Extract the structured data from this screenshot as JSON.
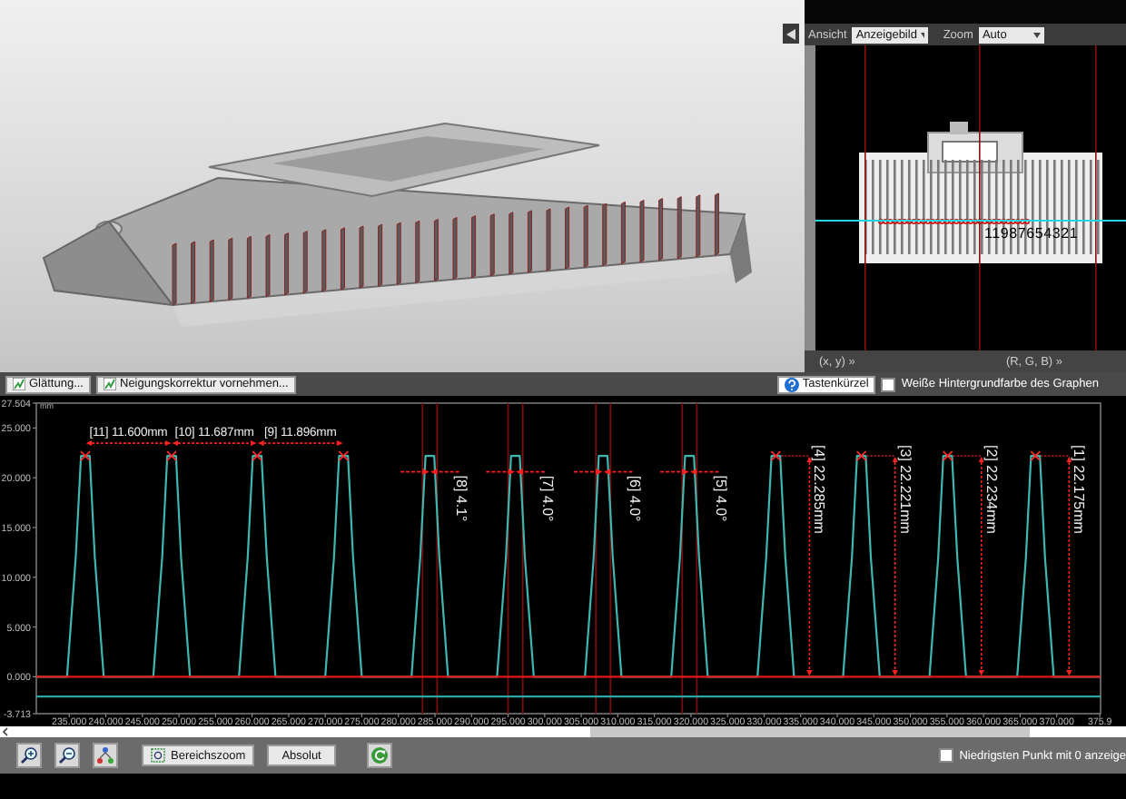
{
  "image_view": {
    "view_label": "Ansicht",
    "view_value": "Anzeigebild",
    "zoom_label": "Zoom",
    "zoom_value": "Auto",
    "peak_numbers": "11987654321",
    "coords_label": "(x, y) »",
    "color_label": "(R, G, B) »"
  },
  "task_tabs": [
    {
      "label": "Glättung..."
    },
    {
      "label": "Neigungskorrektur vornehmen..."
    }
  ],
  "shortcut_button": "Tastenkürzel",
  "white_background": {
    "label": "Weiße Hintergrundfarbe des Graphen",
    "checked": false
  },
  "chart": {
    "unit": "mm",
    "chart_data": {
      "type": "line",
      "xlim": [
        230.5,
        376
      ],
      "ylim": [
        -3.713,
        27.504
      ],
      "x": [
        230.5,
        234.7,
        235.9,
        236.6,
        237.8,
        238.5,
        239.7,
        246.5,
        247.7,
        248.4,
        249.6,
        250.3,
        251.5,
        258.2,
        259.4,
        260.1,
        261.3,
        262.0,
        263.2,
        270.0,
        271.2,
        271.9,
        273.1,
        273.8,
        275.0,
        281.8,
        283.0,
        283.7,
        284.9,
        285.6,
        286.8,
        293.5,
        294.7,
        295.4,
        296.6,
        297.3,
        298.5,
        305.5,
        306.7,
        307.4,
        308.6,
        309.3,
        310.5,
        317.3,
        318.5,
        319.2,
        320.4,
        321.1,
        322.3,
        329.1,
        330.3,
        331.0,
        332.2,
        332.9,
        334.1,
        340.8,
        342.0,
        342.7,
        343.9,
        344.6,
        345.8,
        352.6,
        353.8,
        354.5,
        355.7,
        356.4,
        357.6,
        364.6,
        365.8,
        366.5,
        367.7,
        368.4,
        369.6,
        376
      ],
      "series": [
        {
          "color": "#3fb6b0",
          "values": [
            0,
            0,
            12,
            22.2,
            22.2,
            12,
            0,
            0,
            12,
            22.2,
            22.2,
            12,
            0,
            0,
            12,
            22.2,
            22.2,
            12,
            0,
            0,
            12,
            22.2,
            22.2,
            12,
            0,
            0,
            12,
            22.2,
            22.2,
            12,
            0,
            0,
            12,
            22.2,
            22.2,
            12,
            0,
            0,
            12,
            22.2,
            22.2,
            12,
            0,
            0,
            12,
            22.2,
            22.2,
            12,
            0,
            0,
            12,
            22.2,
            22.2,
            12,
            0,
            0,
            12,
            22.2,
            22.2,
            12,
            0,
            0,
            12,
            22.2,
            22.2,
            12,
            0,
            0,
            12,
            22.2,
            22.2,
            12,
            0,
            0
          ]
        },
        {
          "color": "#e01818",
          "values": [
            0,
            0,
            0,
            0,
            0,
            0,
            0,
            0,
            0,
            0,
            0,
            0,
            0,
            0,
            0,
            0,
            0,
            0,
            0,
            0,
            0,
            0,
            0,
            0,
            0,
            0,
            0,
            0,
            0,
            0,
            0,
            0,
            0,
            0,
            0,
            0,
            0,
            0,
            0,
            0,
            0,
            0,
            0,
            0,
            0,
            0,
            0,
            0,
            0,
            0,
            0,
            0,
            0,
            0,
            0,
            0,
            0,
            0,
            0,
            0,
            0,
            0,
            0,
            0,
            0,
            0,
            0,
            0,
            0,
            0,
            0,
            0,
            0,
            0
          ]
        },
        {
          "color": "#2aa7a7",
          "values": [
            -2,
            -2,
            -2,
            -2,
            -2,
            -2,
            -2,
            -2,
            -2,
            -2,
            -2,
            -2,
            -2,
            -2,
            -2,
            -2,
            -2,
            -2,
            -2,
            -2,
            -2,
            -2,
            -2,
            -2,
            -2,
            -2,
            -2,
            -2,
            -2,
            -2,
            -2,
            -2,
            -2,
            -2,
            -2,
            -2,
            -2,
            -2,
            -2,
            -2,
            -2,
            -2,
            -2,
            -2,
            -2,
            -2,
            -2,
            -2,
            -2,
            -2,
            -2,
            -2,
            -2,
            -2,
            -2,
            -2,
            -2,
            -2,
            -2,
            -2,
            -2,
            -2,
            -2,
            -2,
            -2,
            -2,
            -2,
            -2,
            -2,
            -2,
            -2,
            -2,
            -2,
            -2
          ]
        }
      ],
      "xticks": [
        {
          "value": 235,
          "label": "235.000"
        },
        {
          "value": 240,
          "label": "240.000"
        },
        {
          "value": 245,
          "label": "245.000"
        },
        {
          "value": 250,
          "label": "250.000"
        },
        {
          "value": 255,
          "label": "255.000"
        },
        {
          "value": 260,
          "label": "260.000"
        },
        {
          "value": 265,
          "label": "265.000"
        },
        {
          "value": 270,
          "label": "270.000"
        },
        {
          "value": 275,
          "label": "275.000"
        },
        {
          "value": 280,
          "label": "280.000"
        },
        {
          "value": 285,
          "label": "285.000"
        },
        {
          "value": 290,
          "label": "290.000"
        },
        {
          "value": 295,
          "label": "295.000"
        },
        {
          "value": 300,
          "label": "300.000"
        },
        {
          "value": 305,
          "label": "305.000"
        },
        {
          "value": 310,
          "label": "310.000"
        },
        {
          "value": 315,
          "label": "315.000"
        },
        {
          "value": 320,
          "label": "320.000"
        },
        {
          "value": 325,
          "label": "325.000"
        },
        {
          "value": 330,
          "label": "330.000"
        },
        {
          "value": 335,
          "label": "335.000"
        },
        {
          "value": 340,
          "label": "340.000"
        },
        {
          "value": 345,
          "label": "345.000"
        },
        {
          "value": 350,
          "label": "350.000"
        },
        {
          "value": 355,
          "label": "355.000"
        },
        {
          "value": 360,
          "label": "360.000"
        },
        {
          "value": 365,
          "label": "365.000"
        },
        {
          "value": 370,
          "label": "370.000"
        },
        {
          "value": 375.9,
          "label": "375.9"
        }
      ],
      "yticks": [
        {
          "value": -3.713,
          "label": "-3.713"
        },
        {
          "value": 0,
          "label": "0.000"
        },
        {
          "value": 5,
          "label": "5.000"
        },
        {
          "value": 10,
          "label": "10.000"
        },
        {
          "value": 15,
          "label": "15.000"
        },
        {
          "value": 20,
          "label": "20.000"
        },
        {
          "value": 25,
          "label": "25.000"
        },
        {
          "value": 27.504,
          "label": "27.504"
        }
      ]
    },
    "measurements": [
      {
        "kind": "distance",
        "text": "[11] 11.600mm"
      },
      {
        "kind": "distance",
        "text": "[10] 11.687mm"
      },
      {
        "kind": "distance",
        "text": "[9] 11.896mm"
      },
      {
        "kind": "angle",
        "text": "[8] 4.1°"
      },
      {
        "kind": "angle",
        "text": "[7] 4.0°"
      },
      {
        "kind": "angle",
        "text": "[6] 4.0°"
      },
      {
        "kind": "angle",
        "text": "[5] 4.0°"
      },
      {
        "kind": "height",
        "text": "[4] 22.285mm"
      },
      {
        "kind": "height",
        "text": "[3] 22.221mm"
      },
      {
        "kind": "height",
        "text": "[2] 22.234mm"
      },
      {
        "kind": "height",
        "text": "[1] 22.175mm"
      }
    ]
  },
  "toolbar": {
    "range_zoom": "Bereichszoom",
    "absolute": "Absolut",
    "lowest_zero": {
      "label": "Niedrigsten Punkt mit 0 anzeige",
      "checked": false
    }
  }
}
